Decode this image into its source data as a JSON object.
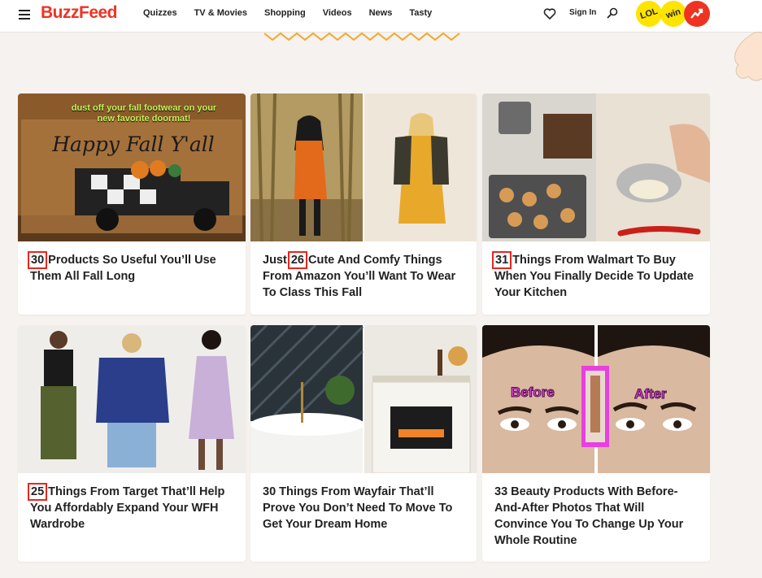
{
  "header": {
    "logo": "BuzzFeed",
    "nav": [
      "Quizzes",
      "TV & Movies",
      "Shopping",
      "Videos",
      "News",
      "Tasty"
    ],
    "signin": "Sign In",
    "badges": {
      "lol": "LOL",
      "win": "win"
    }
  },
  "colors": {
    "brand": "#ee3322",
    "highlight": "#e8261c",
    "badge_yellow": "#ffe400"
  },
  "cards": [
    {
      "num": "30",
      "rest": " Products So Useful You’ll Use Them All Fall Long",
      "image_text_1": "dust off your fall footwear on your",
      "image_text_2": "new favorite doormat!",
      "doormat_text": "Happy Fall Y'all"
    },
    {
      "pre": "Just ",
      "num": "26",
      "rest": " Cute And Comfy Things From Amazon You’ll Want To Wear To Class This Fall"
    },
    {
      "num": "31",
      "rest": " Things From Walmart To Buy When You Finally Decide To Update Your Kitchen"
    },
    {
      "num": "25",
      "rest": " Things From Target That’ll Help You Affordably Expand Your WFH Wardrobe"
    },
    {
      "title": "30 Things From Wayfair That’ll Prove You Don’t Need To Move To Get Your Dream Home"
    },
    {
      "title": "33 Beauty Products With Before-And-After Photos That Will Convince You To Change Up Your Whole Routine",
      "before_label": "Before",
      "after_label": "After"
    }
  ]
}
